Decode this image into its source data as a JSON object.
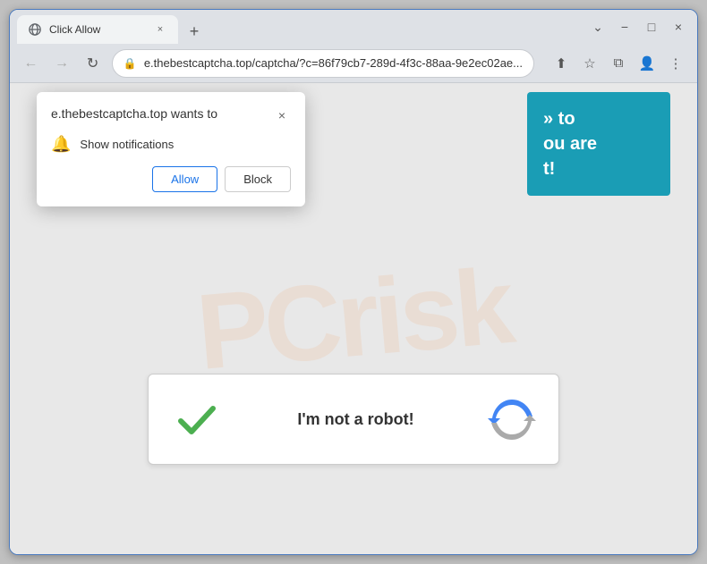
{
  "window": {
    "title": "Click Allow",
    "favicon": "globe",
    "close_label": "×",
    "minimize_label": "−",
    "maximize_label": "□",
    "more_label": "⋮"
  },
  "addressbar": {
    "back_label": "←",
    "forward_label": "→",
    "refresh_label": "↻",
    "url": "e.thebestcaptcha.top/captcha/?c=86f79cb7-289d-4f3c-88aa-9e2ec02ae...",
    "share_label": "⬆",
    "bookmark_label": "☆",
    "split_label": "⧉",
    "profile_label": "👤",
    "menu_label": "⋮"
  },
  "popup": {
    "title": "e.thebestcaptcha.top wants to",
    "close_label": "×",
    "notification_text": "Show notifications",
    "allow_label": "Allow",
    "block_label": "Block"
  },
  "ad_banner": {
    "line1": "» to",
    "line2": "ou are",
    "line3": "t!"
  },
  "captcha": {
    "label": "I'm not a robot!"
  },
  "colors": {
    "accent_blue": "#1a73e8",
    "teal": "#1a9db5",
    "green_check": "#4caf50",
    "recaptcha_blue": "#4285f4"
  }
}
